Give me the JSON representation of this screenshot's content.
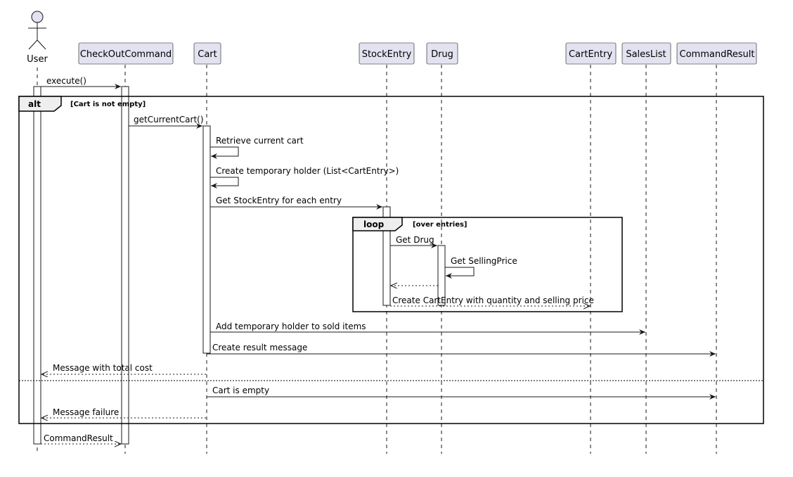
{
  "colors": {
    "participant_fill": "#E2E2F0",
    "participant_border": "#181818",
    "frame_header_fill": "#EEEEEE",
    "line": "#181818",
    "background": "#FFFFFF"
  },
  "participants": [
    {
      "id": "user",
      "label": "User",
      "kind": "actor"
    },
    {
      "id": "checkout",
      "label": "CheckOutCommand",
      "kind": "box"
    },
    {
      "id": "cart",
      "label": "Cart",
      "kind": "box"
    },
    {
      "id": "stockentry",
      "label": "StockEntry",
      "kind": "box"
    },
    {
      "id": "drug",
      "label": "Drug",
      "kind": "box"
    },
    {
      "id": "cartentry",
      "label": "CartEntry",
      "kind": "box"
    },
    {
      "id": "saleslist",
      "label": "SalesList",
      "kind": "box"
    },
    {
      "id": "commandresult",
      "label": "CommandResult",
      "kind": "box"
    }
  ],
  "frames": {
    "alt": {
      "keyword": "alt",
      "guard": "[Cart is not empty]"
    },
    "loop": {
      "keyword": "loop",
      "guard": "[over entries]"
    }
  },
  "messages": [
    {
      "id": "m1",
      "label": "execute()"
    },
    {
      "id": "m2",
      "label": "getCurrentCart()"
    },
    {
      "id": "m3",
      "label": "Retrieve current cart"
    },
    {
      "id": "m4",
      "label": "Create temporary holder (List<CartEntry>)"
    },
    {
      "id": "m5",
      "label": "Get StockEntry for each entry"
    },
    {
      "id": "m6",
      "label": "Get Drug"
    },
    {
      "id": "m7",
      "label": "Get SellingPrice"
    },
    {
      "id": "m8",
      "label": ""
    },
    {
      "id": "m9",
      "label": "Create CartEntry with quantity and selling price"
    },
    {
      "id": "m10",
      "label": "Add temporary holder to sold items"
    },
    {
      "id": "m11",
      "label": "Create result message"
    },
    {
      "id": "m12",
      "label": "Message with total cost"
    },
    {
      "id": "m13",
      "label": "Cart is empty"
    },
    {
      "id": "m14",
      "label": "Message failure"
    },
    {
      "id": "m15",
      "label": "CommandResult"
    }
  ]
}
